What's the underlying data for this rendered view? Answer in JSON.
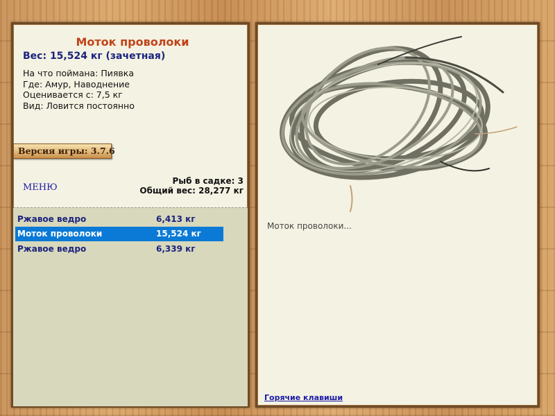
{
  "fish": {
    "title": "Моток проволоки",
    "weight_line": "Вес: 15,524 кг (зачетная)",
    "info": [
      {
        "label": "На что поймана:",
        "value": "Пиявка"
      },
      {
        "label": "Где:",
        "value": "Амур, Наводнение"
      },
      {
        "label": "Оценивается с:",
        "value": "7,5 кг"
      },
      {
        "label": "Вид:",
        "value": "Ловится постоянно"
      }
    ]
  },
  "version": {
    "label": "Версия игры:",
    "value": "3.7.6"
  },
  "menu": {
    "label": "МЕНЮ"
  },
  "keepnet": {
    "count_label": "Рыб в садке:",
    "count": "3",
    "total_label": "Общий вес:",
    "total": "28,277 кг"
  },
  "catches": [
    {
      "name": "Ржавое ведро",
      "weight": "6,413 кг",
      "selected": false
    },
    {
      "name": "Моток проволоки",
      "weight": "15,524 кг",
      "selected": true
    },
    {
      "name": "Ржавое ведро",
      "weight": "6,339 кг",
      "selected": false
    }
  ],
  "preview": {
    "caption": "Моток проволоки...",
    "icon": "wire-coil-image"
  },
  "hotkeys": {
    "label": "Горячие клавиши"
  },
  "colors": {
    "accent_title": "#c0431a",
    "selected_row": "#0a7ad6",
    "link": "#1a1aa8"
  }
}
